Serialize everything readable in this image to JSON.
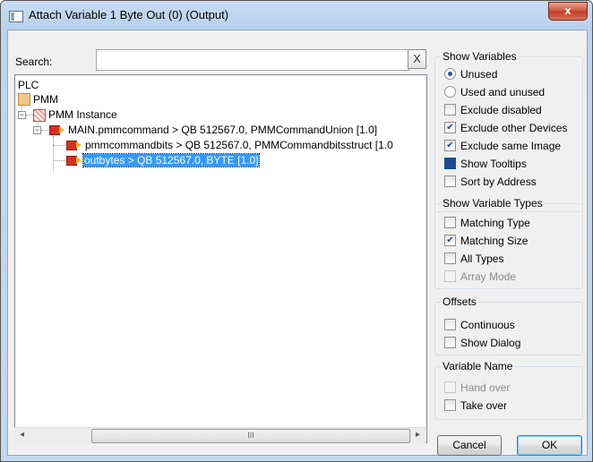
{
  "window": {
    "title": "Attach Variable 1 Byte Out (0) (Output)",
    "close_glyph": "x"
  },
  "search": {
    "label": "Search:",
    "value": "",
    "clear_glyph": "X"
  },
  "tree": {
    "nodes": [
      {
        "label": "PLC"
      },
      {
        "label": "PMM",
        "icon": "plc-project-icon"
      },
      {
        "label": "PMM Instance",
        "icon": "plc-instance-icon",
        "expander": "−"
      },
      {
        "label": "MAIN.pmmcommand   >   QB 512567.0, PMMCommandUnion [1.0]",
        "icon": "output-variable-icon",
        "expander": "−"
      },
      {
        "label": "pmmcommandbits   >   QB 512567.0, PMMCommandbitsstruct [1.0",
        "icon": "output-variable-icon"
      },
      {
        "label": "outbytes   >   QB 512567.0, BYTE [1.0]",
        "icon": "output-variable-icon",
        "selected": true
      }
    ]
  },
  "scrollbar": {
    "left": "◂",
    "right": "▸",
    "grip": "III"
  },
  "show_variables": {
    "legend": "Show Variables",
    "unused": "Unused",
    "used_and_unused": "Used and unused",
    "exclude_disabled": "Exclude disabled",
    "exclude_other_devices": "Exclude other Devices",
    "exclude_same_image": "Exclude same Image",
    "show_tooltips": "Show Tooltips",
    "sort_by_address": "Sort by Address"
  },
  "show_variable_types": {
    "legend": "Show Variable Types",
    "matching_type": "Matching Type",
    "matching_size": "Matching Size",
    "all_types": "All Types",
    "array_mode": "Array Mode"
  },
  "offsets": {
    "legend": "Offsets",
    "continuous": "Continuous",
    "show_dialog": "Show Dialog"
  },
  "variable_name": {
    "legend": "Variable Name",
    "hand_over": "Hand over",
    "take_over": "Take over"
  },
  "buttons": {
    "cancel": "Cancel",
    "ok": "OK"
  }
}
